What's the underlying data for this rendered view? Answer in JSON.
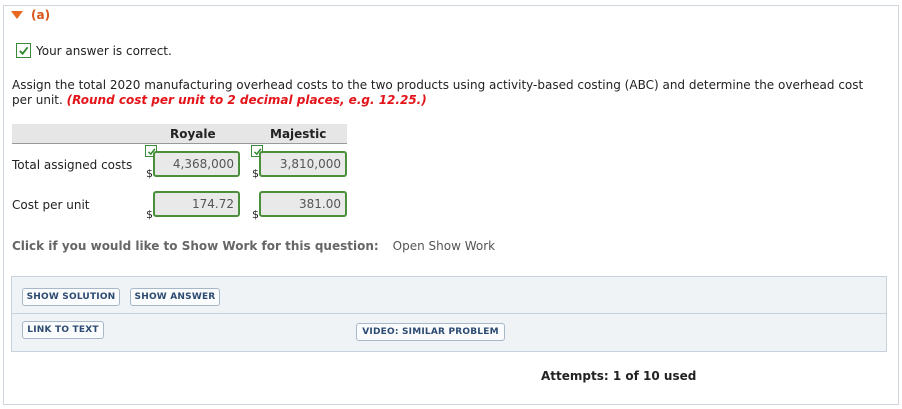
{
  "part": {
    "label": "(a)"
  },
  "status": {
    "message": "Your answer is correct."
  },
  "question": {
    "text": "Assign the total 2020 manufacturing overhead costs to the two products using activity-based costing (ABC) and determine the overhead cost per unit.",
    "hint": "(Round cost per unit to 2 decimal places, e.g. 12.25.)"
  },
  "table": {
    "columns": [
      "Royale",
      "Majestic"
    ],
    "rows": [
      {
        "label": "Total assigned costs",
        "currency": "$",
        "values": [
          "4,368,000",
          "3,810,000"
        ]
      },
      {
        "label": "Cost per unit",
        "currency": "$",
        "values": [
          "174.72",
          "381.00"
        ]
      }
    ]
  },
  "show_work": {
    "prompt": "Click if you would like to Show Work for this question:",
    "link": "Open Show Work"
  },
  "buttons": {
    "show_solution": "SHOW SOLUTION",
    "show_answer": "SHOW ANSWER",
    "link_to_text": "LINK TO TEXT",
    "video": "VIDEO: SIMILAR PROBLEM"
  },
  "attempts": "Attempts: 1 of 10 used",
  "colors": {
    "accent": "#e8681f",
    "correct": "#4a8f3a",
    "hint": "#e3141a",
    "button_text": "#2c4a72"
  }
}
